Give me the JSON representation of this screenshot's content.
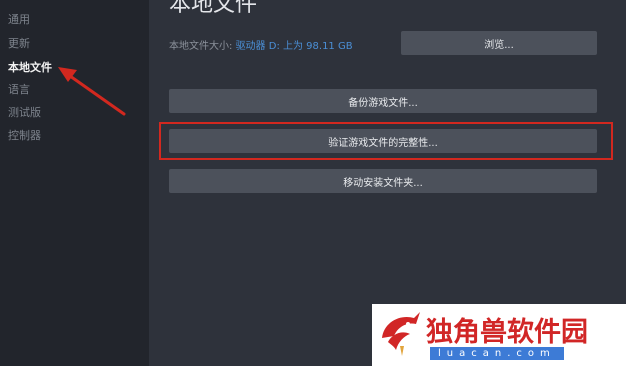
{
  "sidebar": {
    "items": [
      {
        "label": "通用"
      },
      {
        "label": "更新"
      },
      {
        "label": "本地文件"
      },
      {
        "label": "语言"
      },
      {
        "label": "测试版"
      },
      {
        "label": "控制器"
      }
    ],
    "active_index": 2
  },
  "main": {
    "title": "本地文件",
    "size_label": "本地文件大小:",
    "size_value": "驱动器 D: 上为 98.11 GB",
    "browse_button": "浏览...",
    "backup_button": "备份游戏文件...",
    "verify_button": "验证游戏文件的完整性...",
    "move_button": "移动安装文件夹..."
  },
  "annotation": {
    "highlight_color": "#d2281f"
  },
  "watermark": {
    "title": "独角兽软件园",
    "url": "luacan.com"
  }
}
